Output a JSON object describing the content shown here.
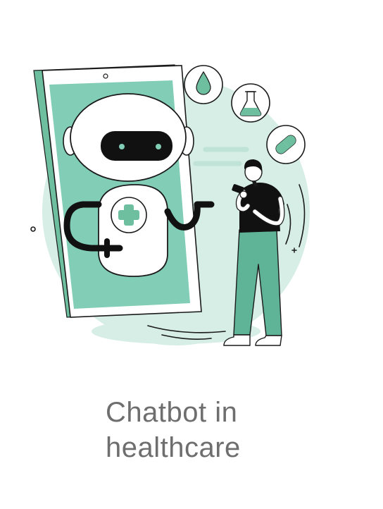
{
  "caption": {
    "line1": "Chatbot in",
    "line2": "healthcare"
  },
  "colors": {
    "mint": "#82cdb6",
    "mint_light": "#d6eee6",
    "outline": "#1a1a1a",
    "shirt": "#111111",
    "pants": "#5fb396",
    "caption_text": "#6e6e6e"
  },
  "icons": [
    "water-drop-icon",
    "flask-icon",
    "pill-icon",
    "medical-cross-icon"
  ]
}
